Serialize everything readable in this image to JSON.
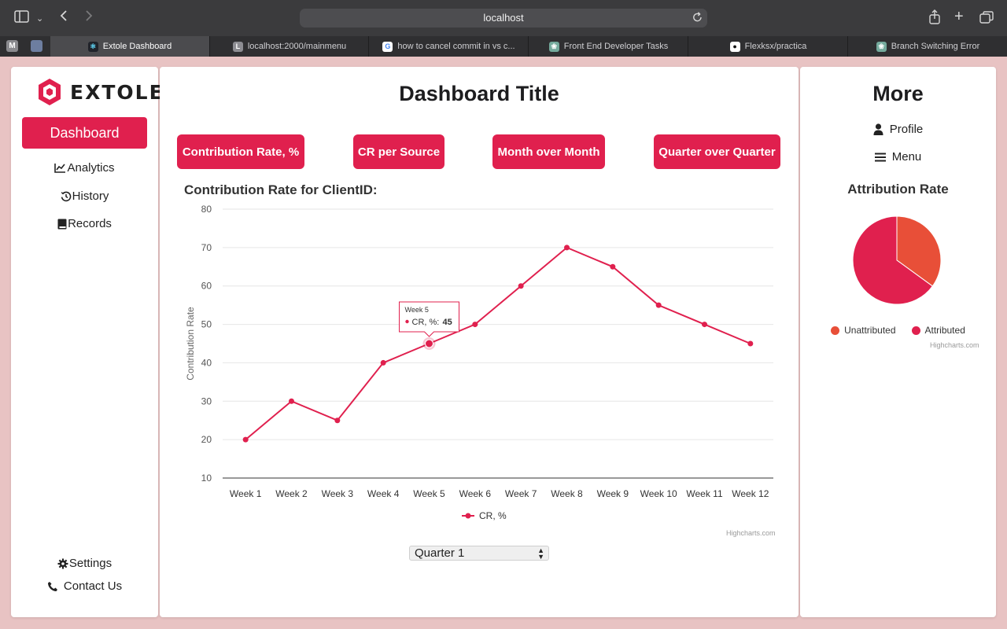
{
  "browser": {
    "address": "localhost",
    "pinned": [
      "M"
    ],
    "tabs": [
      {
        "label": "Extole Dashboard",
        "active": true
      },
      {
        "label": "localhost:2000/mainmenu",
        "active": false
      },
      {
        "label": "how to cancel commit in vs c...",
        "active": false
      },
      {
        "label": "Front End Developer Tasks",
        "active": false
      },
      {
        "label": "Flexksx/practica",
        "active": false
      },
      {
        "label": "Branch Switching Error",
        "active": false
      }
    ]
  },
  "sidebar": {
    "logo_text": "EXTOLE",
    "active_item": "Dashboard",
    "items": [
      {
        "label": "Analytics",
        "icon": "chart-line-icon"
      },
      {
        "label": "History",
        "icon": "history-icon"
      },
      {
        "label": "Records",
        "icon": "book-icon"
      }
    ],
    "bottom": [
      {
        "label": "Settings",
        "icon": "gear-icon"
      },
      {
        "label": "Contact Us",
        "icon": "phone-icon"
      }
    ]
  },
  "main": {
    "title": "Dashboard Title",
    "buttons": [
      "Contribution Rate, %",
      "CR per Source",
      "Month over Month",
      "Quarter over Quarter"
    ],
    "select_value": "Quarter 1",
    "credits": "Highcharts.com"
  },
  "chart_data": [
    {
      "type": "line",
      "title": "Contribution Rate for ClientID:",
      "xlabel": "",
      "ylabel": "Contribution Rate",
      "categories": [
        "Week 1",
        "Week 2",
        "Week 3",
        "Week 4",
        "Week 5",
        "Week 6",
        "Week 7",
        "Week 8",
        "Week 9",
        "Week 10",
        "Week 11",
        "Week 12"
      ],
      "series": [
        {
          "name": "CR, %",
          "values": [
            20,
            30,
            25,
            40,
            45,
            50,
            60,
            70,
            65,
            55,
            50,
            45
          ]
        }
      ],
      "ylim": [
        10,
        80
      ],
      "yticks": [
        10,
        20,
        30,
        40,
        50,
        60,
        70,
        80
      ],
      "grid": true,
      "legend": "bottom-center",
      "color": "#e0204e",
      "tooltip": {
        "category": "Week 5",
        "series": "CR, %",
        "value": "45"
      }
    },
    {
      "type": "pie",
      "title": "Attribution Rate",
      "slices": [
        {
          "name": "Unattributed",
          "value": 35,
          "color": "#e84f38"
        },
        {
          "name": "Attributed",
          "value": 65,
          "color": "#e0204e"
        }
      ],
      "legend": "bottom-center"
    }
  ],
  "right": {
    "title": "More",
    "links": [
      {
        "label": "Profile",
        "icon": "user-icon"
      },
      {
        "label": "Menu",
        "icon": "hamburger-icon"
      }
    ],
    "credits": "Highcharts.com"
  }
}
